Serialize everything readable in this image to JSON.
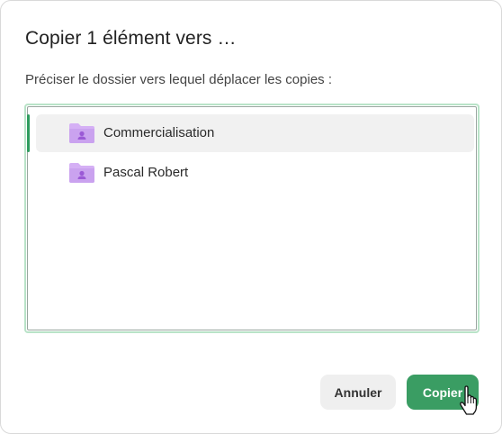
{
  "dialog": {
    "title": "Copier 1 élément vers …",
    "subtitle": "Préciser le dossier vers lequel déplacer les copies :"
  },
  "folders": [
    {
      "label": "Commercialisation",
      "icon": "shared-folder-icon",
      "selected": true
    },
    {
      "label": "Pascal Robert",
      "icon": "shared-folder-icon",
      "selected": false
    }
  ],
  "buttons": {
    "cancel_label": "Annuler",
    "copy_label": "Copier"
  },
  "colors": {
    "accent": "#3a9d63",
    "folder": "#cfa8f0",
    "selection_bar": "#2e9c5e"
  }
}
